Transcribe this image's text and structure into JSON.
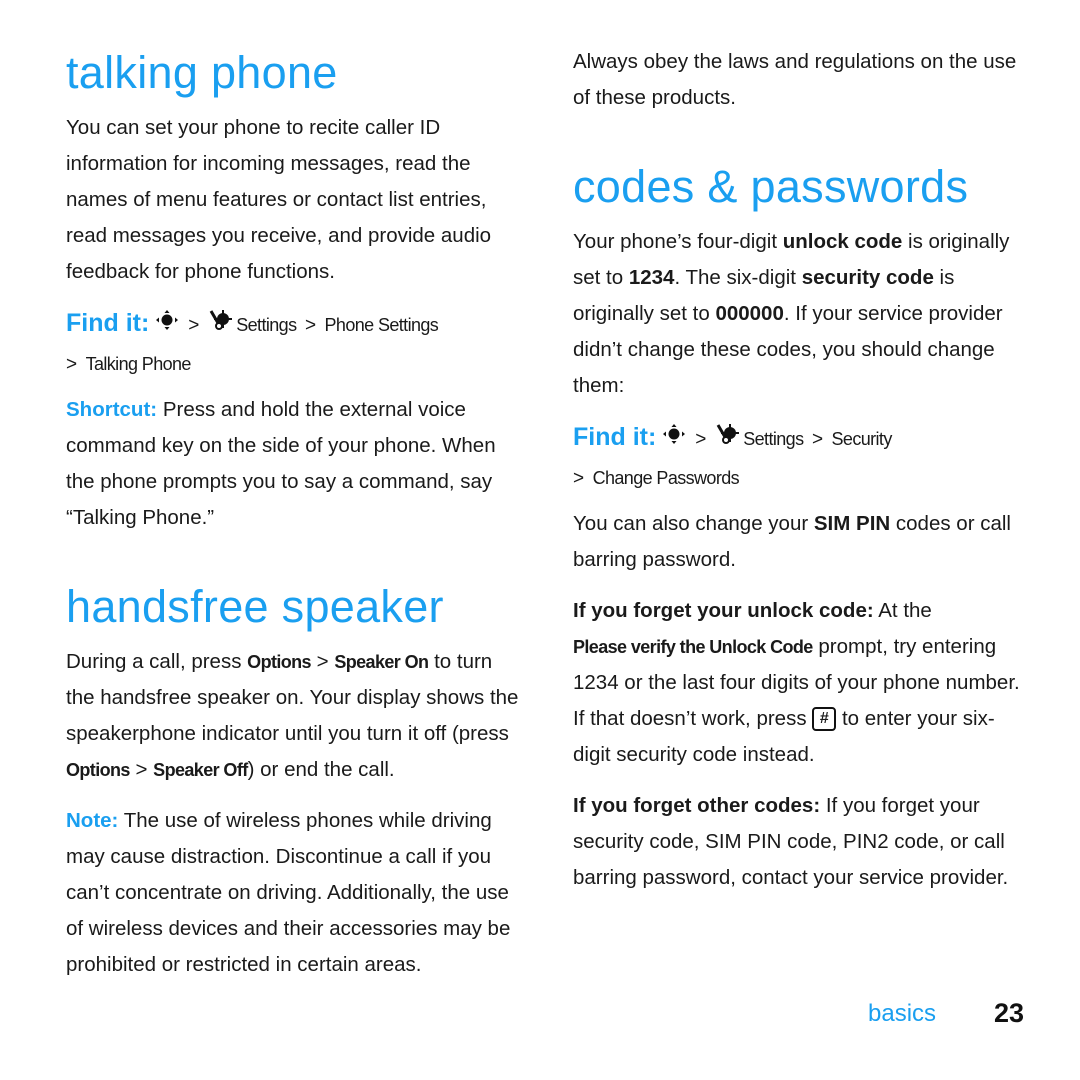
{
  "left": {
    "talking_phone": {
      "title": "talking phone",
      "body": "You can set your phone to recite caller ID information for incoming messages, read the names of menu features or contact list entries, read messages you receive, and provide audio feedback for phone functions.",
      "findit_label": "Find it:",
      "path": [
        "Settings",
        "Phone Settings",
        "Talking Phone"
      ],
      "shortcut_label": "Shortcut:",
      "shortcut_text": "Press and hold the external voice command key on the side of your phone. When the phone prompts you to say a command, say “Talking Phone.”"
    },
    "handsfree": {
      "title": "handsfree speaker",
      "p1_a": "During a call, press ",
      "options": "Options",
      "speaker_on": "Speaker On",
      "p1_b": " to turn the handsfree speaker on. Your display shows the speakerphone indicator until you turn it off (press ",
      "speaker_off": "Speaker Off",
      "p1_c": ") or end the call.",
      "note_label": "Note:",
      "note_text": "The use of wireless phones while driving may cause distraction. Discontinue a call if you can’t concentrate on driving. Additionally, the use of wireless devices and their accessories may be prohibited or restricted in certain areas."
    }
  },
  "right": {
    "intro": "Always obey the laws and regulations on the use of these products.",
    "codes": {
      "title": "codes & passwords",
      "p1_a": "Your phone’s four-digit ",
      "unlock_code": "unlock code",
      "p1_b": " is originally set to ",
      "code_1234": "1234",
      "p1_c": ". The six-digit ",
      "security_code": "security code",
      "p1_d": " is originally set to ",
      "code_000000": "000000",
      "p1_e": ". If your service provider didn’t change these codes, you should change them:",
      "findit_label": "Find it:",
      "path": [
        "Settings",
        "Security",
        "Change Passwords"
      ],
      "p2_a": "You can also change your ",
      "sim_pin": "SIM PIN",
      "p2_b": " codes or call barring password.",
      "forget_unlock_label": "If you forget your unlock code:",
      "fu_a": " At the ",
      "prompt": "Please verify the Unlock Code",
      "fu_b": " prompt, try entering 1234 or the last four digits of your phone number. If that doesn’t work, press ",
      "key": "#",
      "fu_c": " to enter your six-digit security code instead.",
      "forget_other_label": "If you forget other codes:",
      "fo_text": " If you forget your security code, SIM PIN code, PIN2 code, or call barring password, contact your service provider."
    }
  },
  "footer": {
    "section": "basics",
    "page": "23"
  },
  "colors": {
    "accent": "#1a9ff0",
    "text": "#1a1a1a"
  }
}
